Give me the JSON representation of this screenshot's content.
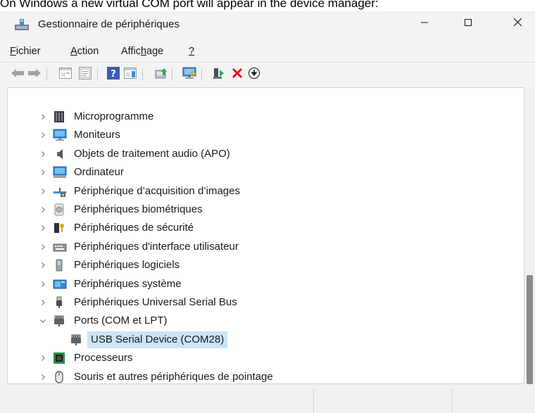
{
  "caption": "On Windows a new virtual COM port will appear in the device manager:",
  "window": {
    "title": "Gestionnaire de périphériques",
    "controls": {
      "minimize_icon": "minimize-icon",
      "maximize_icon": "maximize-icon",
      "close_icon": "close-icon"
    }
  },
  "menu": {
    "fichier": {
      "underlined": "F",
      "rest": "ichier"
    },
    "action": {
      "underlined": "A",
      "rest": "ction"
    },
    "affichage": {
      "before": "Affic",
      "underlined": "h",
      "after": "age"
    },
    "help": {
      "underlined": "?"
    }
  },
  "toolbar": [
    "back-arrow-icon",
    "forward-arrow-icon",
    "properties-pane-icon",
    "console-tree-icon",
    "help-icon",
    "action-pane-icon",
    "update-driver-icon",
    "scan-hardware-icon",
    "enable-device-icon",
    "uninstall-device-icon",
    "download-driver-icon"
  ],
  "tree": {
    "items": [
      {
        "label": "Microprogramme",
        "icon": "firmware-icon",
        "expanded": false
      },
      {
        "label": "Moniteurs",
        "icon": "monitor-icon",
        "expanded": false
      },
      {
        "label": "Objets de traitement audio (APO)",
        "icon": "speaker-icon",
        "expanded": false
      },
      {
        "label": "Ordinateur",
        "icon": "computer-icon",
        "expanded": false
      },
      {
        "label": "Périphérique d’acquisition d’images",
        "icon": "camera-icon",
        "expanded": false
      },
      {
        "label": "Périphériques biométriques",
        "icon": "fingerprint-icon",
        "expanded": false
      },
      {
        "label": "Périphériques de sécurité",
        "icon": "security-key-icon",
        "expanded": false
      },
      {
        "label": "Périphériques d'interface utilisateur",
        "icon": "keyboard-icon",
        "expanded": false
      },
      {
        "label": "Périphériques logiciels",
        "icon": "software-device-icon",
        "expanded": false
      },
      {
        "label": "Périphériques système",
        "icon": "system-device-icon",
        "expanded": false
      },
      {
        "label": "Périphériques Universal Serial Bus",
        "icon": "usb-icon",
        "expanded": false
      },
      {
        "label": "Ports (COM et LPT)",
        "icon": "port-icon",
        "expanded": true
      },
      {
        "label": "USB Serial Device (COM28)",
        "icon": "port-icon",
        "child": true,
        "selected": true
      },
      {
        "label": "Processeurs",
        "icon": "processor-icon",
        "expanded": false
      },
      {
        "label": "Souris et autres périphériques de pointage",
        "icon": "mouse-icon",
        "expanded": false
      }
    ]
  },
  "colors": {
    "selection": "#cce4f7",
    "uninstall_red": "#e81123",
    "window_bg": "#f3f3f3"
  }
}
